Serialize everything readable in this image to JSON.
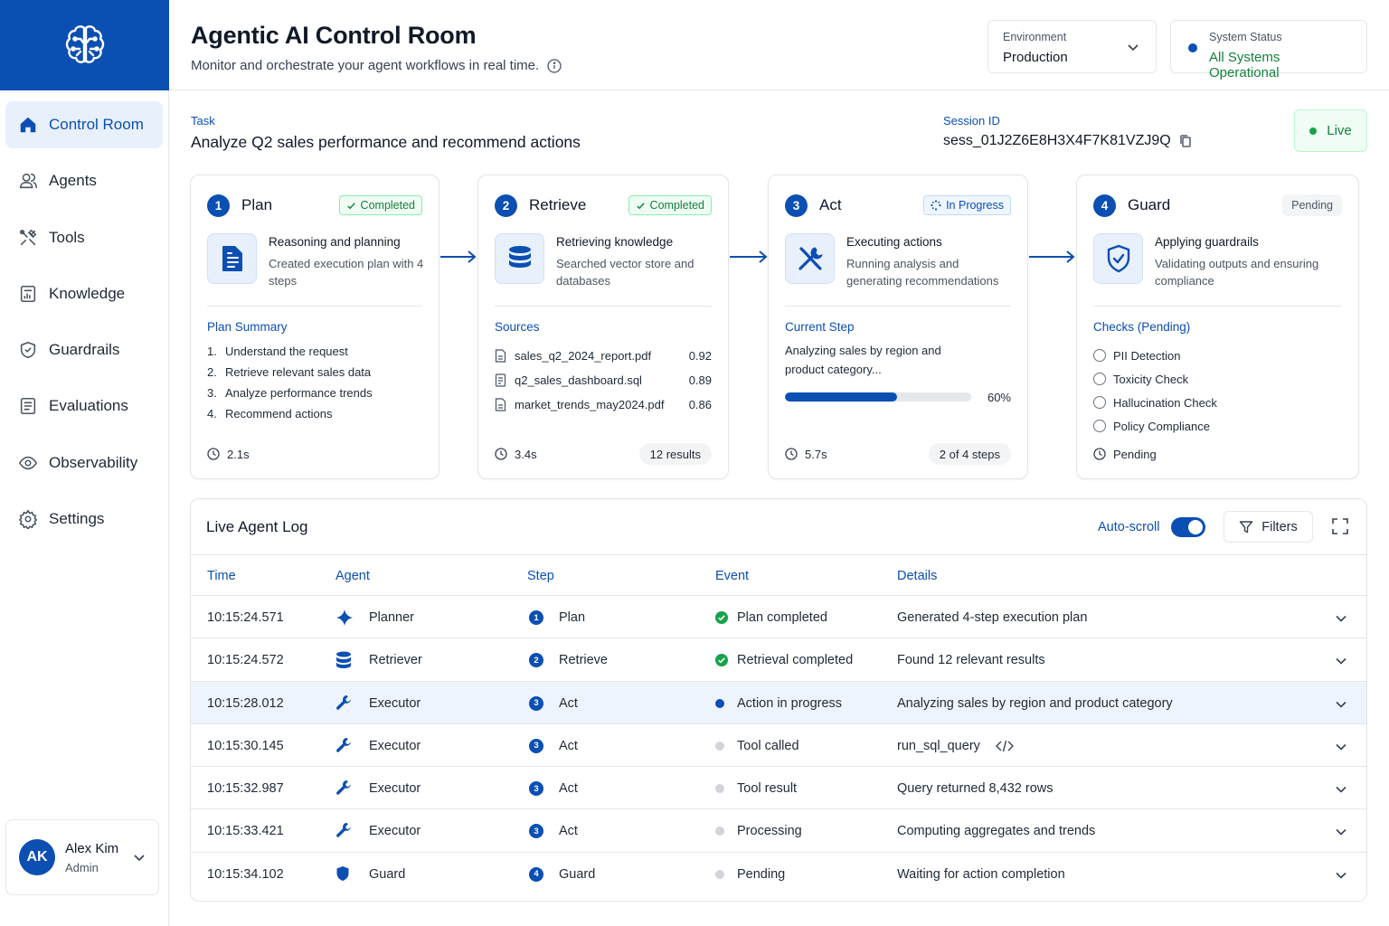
{
  "header": {
    "title": "Agentic AI Control Room",
    "subtitle": "Monitor and orchestrate your agent workflows in real time.",
    "environment": {
      "label": "Environment",
      "value": "Production"
    },
    "system_status": {
      "label": "System Status",
      "value": "All Systems Operational"
    }
  },
  "sidebar": {
    "items": [
      {
        "label": "Control Room",
        "icon": "home-icon",
        "active": true
      },
      {
        "label": "Agents",
        "icon": "agents-icon"
      },
      {
        "label": "Tools",
        "icon": "tools-icon"
      },
      {
        "label": "Knowledge",
        "icon": "knowledge-icon"
      },
      {
        "label": "Guardrails",
        "icon": "shield-icon"
      },
      {
        "label": "Evaluations",
        "icon": "clipboard-icon"
      },
      {
        "label": "Observability",
        "icon": "eye-icon"
      },
      {
        "label": "Settings",
        "icon": "gear-icon"
      }
    ],
    "user": {
      "initials": "AK",
      "name": "Alex Kim",
      "role": "Admin"
    }
  },
  "task": {
    "label": "Task",
    "title": "Analyze Q2 sales performance and recommend actions",
    "session_label": "Session ID",
    "session_id": "sess_01J2Z6E8H3X4F7K81VZJ9Q",
    "live": "Live"
  },
  "steps": {
    "plan": {
      "num": "1",
      "title": "Plan",
      "status": "Completed",
      "desc_title": "Reasoning and planning",
      "desc_body": "Created execution plan with 4 steps",
      "section": "Plan Summary",
      "items": [
        {
          "num": "1.",
          "text": "Understand the request"
        },
        {
          "num": "2.",
          "text": "Retrieve relevant sales data"
        },
        {
          "num": "3.",
          "text": "Analyze performance trends"
        },
        {
          "num": "4.",
          "text": "Recommend actions"
        }
      ],
      "duration": "2.1s"
    },
    "retrieve": {
      "num": "2",
      "title": "Retrieve",
      "status": "Completed",
      "desc_title": "Retrieving knowledge",
      "desc_body": "Searched vector store and databases",
      "section": "Sources",
      "sources": [
        {
          "name": "sales_q2_2024_report.pdf",
          "score": "0.92"
        },
        {
          "name": "q2_sales_dashboard.sql",
          "score": "0.89"
        },
        {
          "name": "market_trends_may2024.pdf",
          "score": "0.86"
        }
      ],
      "duration": "3.4s",
      "results": "12 results"
    },
    "act": {
      "num": "3",
      "title": "Act",
      "status": "In Progress",
      "desc_title": "Executing actions",
      "desc_body": "Running analysis and generating recommendations",
      "section": "Current Step",
      "current": "Analyzing sales by region and product category...",
      "progress": 0.6,
      "progress_label": "60%",
      "duration": "5.7s",
      "steps_done": "2 of 4 steps"
    },
    "guard": {
      "num": "4",
      "title": "Guard",
      "status": "Pending",
      "desc_title": "Applying guardrails",
      "desc_body": "Validating outputs and ensuring compliance",
      "section": "Checks (Pending)",
      "checks": [
        "PII Detection",
        "Toxicity Check",
        "Hallucination Check",
        "Policy Compliance"
      ],
      "footer": "Pending"
    }
  },
  "log": {
    "title": "Live Agent Log",
    "autoscroll_label": "Auto-scroll",
    "autoscroll_on": true,
    "filters_label": "Filters",
    "columns": [
      "Time",
      "Agent",
      "Step",
      "Event",
      "Details"
    ],
    "rows": [
      {
        "time": "10:15:24.571",
        "agent": "Planner",
        "agent_icon": "sparkle-icon",
        "step_num": "1",
        "step": "Plan",
        "event": "Plan completed",
        "event_icon": "check-circle-icon",
        "details": "Generated 4-step execution plan"
      },
      {
        "time": "10:15:24.572",
        "agent": "Retriever",
        "agent_icon": "database-icon",
        "step_num": "2",
        "step": "Retrieve",
        "event": "Retrieval completed",
        "event_icon": "check-circle-icon",
        "details": "Found 12 relevant results"
      },
      {
        "time": "10:15:28.012",
        "agent": "Executor",
        "agent_icon": "wrench-icon",
        "step_num": "3",
        "step": "Act",
        "event": "Action in progress",
        "event_icon": "blue-dot-icon",
        "details": "Analyzing sales by region and product category",
        "highlight": true
      },
      {
        "time": "10:15:30.145",
        "agent": "Executor",
        "agent_icon": "wrench-icon",
        "step_num": "3",
        "step": "Act",
        "event": "Tool called",
        "event_icon": "grey-dot-icon",
        "details": "run_sql_query",
        "has_code_icon": true
      },
      {
        "time": "10:15:32.987",
        "agent": "Executor",
        "agent_icon": "wrench-icon",
        "step_num": "3",
        "step": "Act",
        "event": "Tool result",
        "event_icon": "grey-dot-icon",
        "details": "Query returned 8,432 rows"
      },
      {
        "time": "10:15:33.421",
        "agent": "Executor",
        "agent_icon": "wrench-icon",
        "step_num": "3",
        "step": "Act",
        "event": "Processing",
        "event_icon": "grey-dot-icon",
        "details": "Computing aggregates and trends"
      },
      {
        "time": "10:15:34.102",
        "agent": "Guard",
        "agent_icon": "shield-icon",
        "step_num": "4",
        "step": "Guard",
        "event": "Pending",
        "event_icon": "grey-dot-icon",
        "details": "Waiting for action completion"
      }
    ]
  },
  "colors": {
    "brand": "#0b4fb3",
    "success": "#15803d",
    "highlight_row": "#eef4fc"
  }
}
